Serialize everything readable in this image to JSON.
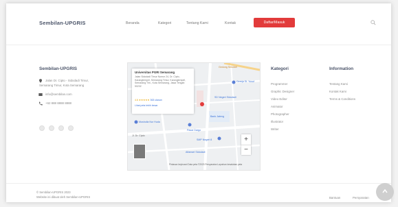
{
  "header": {
    "brand": "Sembilan-UPGRIS",
    "nav": [
      "Beranda",
      "Kategori",
      "Tentang Kami",
      "Kontak"
    ],
    "cta_label": "Daftar/Masuk"
  },
  "footer": {
    "brand": "Sembilan-UPGRIS",
    "address": [
      "Jalan Dr. Cipto - Sidodadi Timur,",
      "Semarang Timur, Kota Semarang"
    ],
    "email": "info@sembilan.com",
    "phone": "+62 888 8888 8888",
    "social_icons": [
      "facebook-icon",
      "twitter-icon",
      "instagram-icon",
      "youtube-icon"
    ]
  },
  "map": {
    "place_name": "Universitas PGRI Semarang",
    "address": "Jalan Sidodadi Timur Nomor 24, Dr. Cipto, Karangtempel, Semarang Timur, Karangtempel, Semarang Tim., Kota Semarang, Jawa Tengah 50232",
    "rating": "4.6 ★★★★★",
    "reviews": "363 ulasan",
    "view_larger": "Lihat peta lebih besar",
    "labels": [
      "Gedung Sekolah",
      "Gereja St. Yusuf",
      "SD Negeri Sidodadi",
      "Bank Jateng",
      "Pasar Dargo",
      "Musholla Nur Huda",
      "Jl. Dr. Cipto",
      "SMP Negeri 8",
      "Alfamart Sidodadi"
    ],
    "attribution": "Pintasan keyboard  Data peta ©2023  Persyaratan  Laporkan kesalahan peta"
  },
  "kategori": {
    "title": "Kategori",
    "items": [
      "Programmer",
      "Graphic Designer",
      "Video Editor",
      "Animator",
      "Photographer",
      "Illustrator",
      "Writer"
    ]
  },
  "information": {
    "title": "Information",
    "items": [
      "Tentang Kami",
      "Kontak Kami",
      "Terms & Conditions"
    ]
  },
  "bottom": {
    "copyright": "© Sembilan-UPGRIS 2023",
    "credit": "Website ini dibuat oleh Sembilan-UPGRIS",
    "links": [
      "Bantuan",
      "Persyaratan"
    ]
  }
}
